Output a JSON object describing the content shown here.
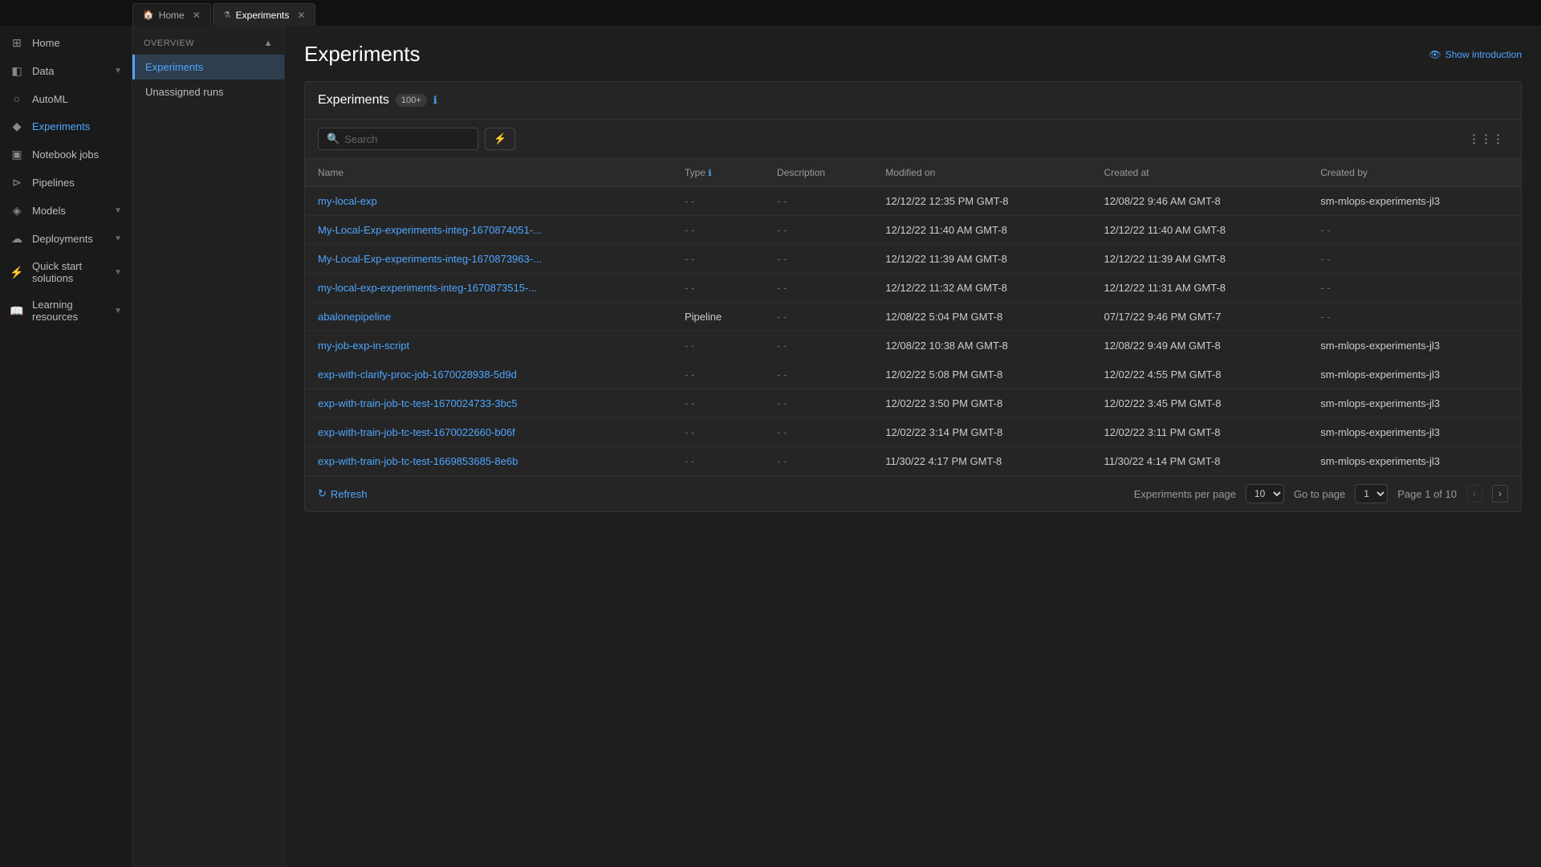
{
  "tabs": [
    {
      "id": "home",
      "icon": "🏠",
      "label": "Home",
      "active": false
    },
    {
      "id": "experiments",
      "icon": "⚗",
      "label": "Experiments",
      "active": true
    }
  ],
  "sidebar": {
    "items": [
      {
        "id": "home",
        "icon": "⊞",
        "label": "Home",
        "arrow": false
      },
      {
        "id": "data",
        "icon": "◧",
        "label": "Data",
        "arrow": true
      },
      {
        "id": "automl",
        "icon": "○",
        "label": "AutoML",
        "arrow": false
      },
      {
        "id": "experiments",
        "icon": "◆",
        "label": "Experiments",
        "arrow": false,
        "active": true
      },
      {
        "id": "notebook-jobs",
        "icon": "▣",
        "label": "Notebook jobs",
        "arrow": false
      },
      {
        "id": "pipelines",
        "icon": "⊳",
        "label": "Pipelines",
        "arrow": false
      },
      {
        "id": "models",
        "icon": "◈",
        "label": "Models",
        "arrow": true
      },
      {
        "id": "deployments",
        "icon": "☁",
        "label": "Deployments",
        "arrow": true
      },
      {
        "id": "quick-start",
        "icon": "⚡",
        "label": "Quick start solutions",
        "arrow": true
      },
      {
        "id": "learning",
        "icon": "📖",
        "label": "Learning resources",
        "arrow": true
      }
    ]
  },
  "nav_panel": {
    "header": "OVERVIEW",
    "items": [
      {
        "id": "experiments",
        "label": "Experiments",
        "active": true
      },
      {
        "id": "unassigned",
        "label": "Unassigned runs",
        "active": false
      }
    ]
  },
  "page": {
    "title": "Experiments",
    "show_intro": "Show introduction",
    "table": {
      "title": "Experiments",
      "badge": "100+",
      "search_placeholder": "Search",
      "columns": [
        "Name",
        "Type",
        "Description",
        "Modified on",
        "Created at",
        "Created by"
      ],
      "rows": [
        {
          "name": "my-local-exp",
          "type": "- -",
          "description": "- -",
          "modified": "12/12/22 12:35 PM GMT-8",
          "created": "12/08/22 9:46 AM GMT-8",
          "created_by": "sm-mlops-experiments-jl3"
        },
        {
          "name": "My-Local-Exp-experiments-integ-1670874051-...",
          "type": "- -",
          "description": "- -",
          "modified": "12/12/22 11:40 AM GMT-8",
          "created": "12/12/22 11:40 AM GMT-8",
          "created_by": "- -"
        },
        {
          "name": "My-Local-Exp-experiments-integ-1670873963-...",
          "type": "- -",
          "description": "- -",
          "modified": "12/12/22 11:39 AM GMT-8",
          "created": "12/12/22 11:39 AM GMT-8",
          "created_by": "- -"
        },
        {
          "name": "my-local-exp-experiments-integ-1670873515-...",
          "type": "- -",
          "description": "- -",
          "modified": "12/12/22 11:32 AM GMT-8",
          "created": "12/12/22 11:31 AM GMT-8",
          "created_by": "- -"
        },
        {
          "name": "abalonepipeline",
          "type": "Pipeline",
          "description": "- -",
          "modified": "12/08/22 5:04 PM GMT-8",
          "created": "07/17/22 9:46 PM GMT-7",
          "created_by": "- -"
        },
        {
          "name": "my-job-exp-in-script",
          "type": "- -",
          "description": "- -",
          "modified": "12/08/22 10:38 AM GMT-8",
          "created": "12/08/22 9:49 AM GMT-8",
          "created_by": "sm-mlops-experiments-jl3"
        },
        {
          "name": "exp-with-clarify-proc-job-1670028938-5d9d",
          "type": "- -",
          "description": "- -",
          "modified": "12/02/22 5:08 PM GMT-8",
          "created": "12/02/22 4:55 PM GMT-8",
          "created_by": "sm-mlops-experiments-jl3"
        },
        {
          "name": "exp-with-train-job-tc-test-1670024733-3bc5",
          "type": "- -",
          "description": "- -",
          "modified": "12/02/22 3:50 PM GMT-8",
          "created": "12/02/22 3:45 PM GMT-8",
          "created_by": "sm-mlops-experiments-jl3"
        },
        {
          "name": "exp-with-train-job-tc-test-1670022660-b06f",
          "type": "- -",
          "description": "- -",
          "modified": "12/02/22 3:14 PM GMT-8",
          "created": "12/02/22 3:11 PM GMT-8",
          "created_by": "sm-mlops-experiments-jl3"
        },
        {
          "name": "exp-with-train-job-tc-test-1669853685-8e6b",
          "type": "- -",
          "description": "- -",
          "modified": "11/30/22 4:17 PM GMT-8",
          "created": "11/30/22 4:14 PM GMT-8",
          "created_by": "sm-mlops-experiments-jl3"
        }
      ],
      "footer": {
        "refresh_label": "Refresh",
        "per_page_label": "Experiments per page",
        "per_page_value": "10",
        "go_to_label": "Go to page",
        "go_to_value": "1",
        "page_info": "Page 1 of 10"
      }
    }
  }
}
